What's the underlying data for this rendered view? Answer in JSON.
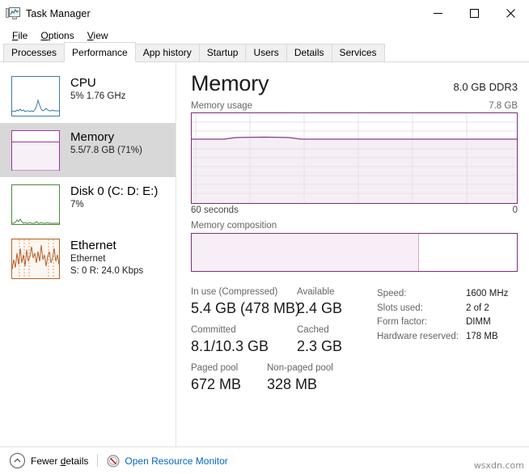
{
  "window": {
    "title": "Task Manager",
    "icon": "task-manager-icon",
    "controls": {
      "minimize": "minimize-icon",
      "maximize": "maximize-icon",
      "close": "close-icon"
    }
  },
  "menu": {
    "items": [
      {
        "label": "File",
        "accel": "F"
      },
      {
        "label": "Options",
        "accel": "O"
      },
      {
        "label": "View",
        "accel": "V"
      }
    ]
  },
  "tabs": {
    "active": "Performance",
    "items": [
      {
        "label": "Processes"
      },
      {
        "label": "Performance"
      },
      {
        "label": "App history"
      },
      {
        "label": "Startup"
      },
      {
        "label": "Users"
      },
      {
        "label": "Details"
      },
      {
        "label": "Services"
      }
    ]
  },
  "sidebar": {
    "items": [
      {
        "name": "cpu",
        "title": "CPU",
        "sub": "5%  1.76 GHz",
        "sub2": "",
        "selected": false,
        "color": "#3a7d9e"
      },
      {
        "name": "memory",
        "title": "Memory",
        "sub": "5.5/7.8 GB (71%)",
        "sub2": "",
        "selected": true,
        "color": "#a034a0"
      },
      {
        "name": "disk",
        "title": "Disk 0 (C: D: E:)",
        "sub": "7%",
        "sub2": "",
        "selected": false,
        "color": "#4a8a3c"
      },
      {
        "name": "ethernet",
        "title": "Ethernet",
        "sub": "Ethernet",
        "sub2": "S: 0 R: 24.0 Kbps",
        "selected": false,
        "color": "#b4612a"
      }
    ]
  },
  "main": {
    "title": "Memory",
    "spec": "8.0 GB DDR3",
    "usage_label": "Memory usage",
    "usage_max": "7.8 GB",
    "axis_left": "60 seconds",
    "axis_right": "0",
    "composition_label": "Memory composition",
    "stats": [
      {
        "label": "In use (Compressed)",
        "value": "5.4 GB (478 MB)"
      },
      {
        "label": "Available",
        "value": "2.4 GB"
      },
      {
        "label": "Committed",
        "value": "8.1/10.3 GB"
      },
      {
        "label": "Cached",
        "value": "2.3 GB"
      },
      {
        "label": "Paged pool",
        "value": "672 MB"
      },
      {
        "label": "Non-paged pool",
        "value": "328 MB"
      }
    ],
    "info": [
      {
        "key": "Speed:",
        "value": "1600 MHz"
      },
      {
        "key": "Slots used:",
        "value": "2 of 2"
      },
      {
        "key": "Form factor:",
        "value": "DIMM"
      },
      {
        "key": "Hardware reserved:",
        "value": "178 MB"
      }
    ]
  },
  "chart_data": {
    "type": "area",
    "title": "Memory usage",
    "ylabel": "GB",
    "xlabel": "seconds",
    "ylim": [
      0,
      7.8
    ],
    "xlim": [
      60,
      0
    ],
    "grid": true,
    "grid_cols": 6,
    "grid_rows": 10,
    "line_color": "#8a3a8a",
    "fill_color": "#f5eff5",
    "current_percent": 71,
    "x": [
      60,
      54,
      48,
      42,
      36,
      30,
      24,
      18,
      12,
      6,
      0
    ],
    "values": [
      5.45,
      5.45,
      5.46,
      5.52,
      5.55,
      5.52,
      5.46,
      5.45,
      5.45,
      5.45,
      5.45
    ],
    "composition": {
      "type": "bar",
      "categories": [
        "In use",
        "Available"
      ],
      "values": [
        70,
        30
      ],
      "colors": [
        "#f7eef7",
        "#ffffff"
      ]
    }
  },
  "statusbar": {
    "fewer_details": "Fewer details",
    "fewer_accel": "d",
    "resource_monitor": "Open Resource Monitor",
    "link_color": "#0066cc"
  },
  "watermark": "wsxdn.com"
}
